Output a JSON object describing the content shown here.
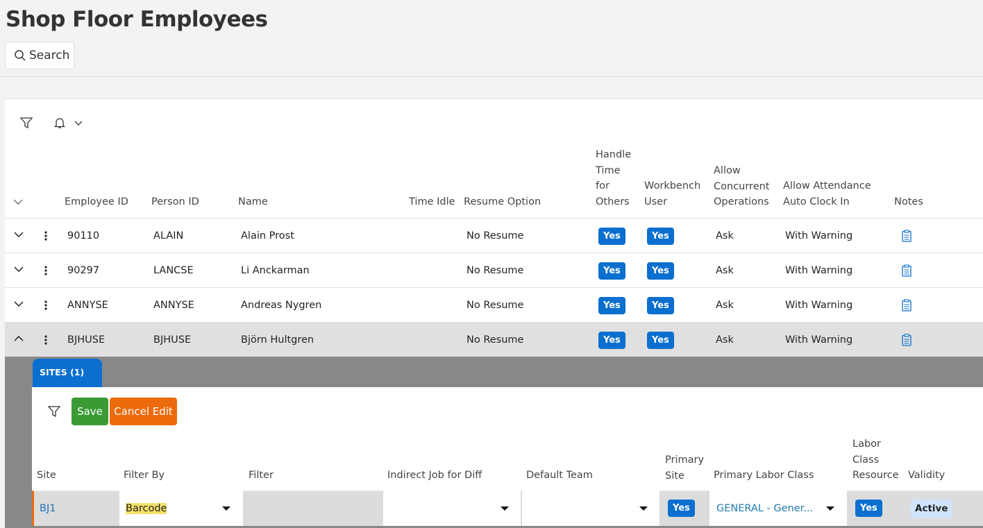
{
  "page": {
    "title": "Shop Floor Employees",
    "search_label": "Search"
  },
  "grid": {
    "headers": {
      "employee_id": "Employee ID",
      "person_id": "Person ID",
      "name": "Name",
      "time_idle": "Time Idle",
      "resume_option": "Resume Option",
      "handle_time": [
        "Handle",
        "Time",
        "for",
        "Others"
      ],
      "workbench": [
        "Workbench",
        "User"
      ],
      "concurrent": [
        "Allow",
        "Concurrent",
        "Operations"
      ],
      "attendance": [
        "Allow Attendance",
        "Auto Clock In"
      ],
      "notes": "Notes"
    },
    "rows": [
      {
        "employee_id": "90110",
        "person_id": "ALAIN",
        "name": "Alain Prost",
        "time_idle": "",
        "resume_option": "No Resume",
        "handle_time": "Yes",
        "workbench": "Yes",
        "concurrent": "Ask",
        "attendance": "With Warning",
        "expanded": false
      },
      {
        "employee_id": "90297",
        "person_id": "LANCSE",
        "name": "Li Anckarman",
        "time_idle": "",
        "resume_option": "No Resume",
        "handle_time": "Yes",
        "workbench": "Yes",
        "concurrent": "Ask",
        "attendance": "With Warning",
        "expanded": false
      },
      {
        "employee_id": "ANNYSE",
        "person_id": "ANNYSE",
        "name": "Andreas Nygren",
        "time_idle": "",
        "resume_option": "No Resume",
        "handle_time": "Yes",
        "workbench": "Yes",
        "concurrent": "Ask",
        "attendance": "With Warning",
        "expanded": false
      },
      {
        "employee_id": "BJHUSE",
        "person_id": "BJHUSE",
        "name": "Björn Hultgren",
        "time_idle": "",
        "resume_option": "No Resume",
        "handle_time": "Yes",
        "workbench": "Yes",
        "concurrent": "Ask",
        "attendance": "With Warning",
        "expanded": true
      }
    ]
  },
  "sites": {
    "tab_label": "SITES (1)",
    "save_label": "Save",
    "cancel_label": "Cancel Edit",
    "headers": {
      "site": "Site",
      "filter_by": "Filter By",
      "filter": "Filter",
      "indirect_job": "Indirect Job for Diff",
      "default_team": "Default Team",
      "primary_site": [
        "Primary",
        "Site"
      ],
      "primary_labor_class": "Primary Labor Class",
      "labor_class_resource": [
        "Labor",
        "Class",
        "Resource"
      ],
      "validity": "Validity"
    },
    "row": {
      "site": "BJ1",
      "filter_by": "Barcode",
      "filter": "",
      "indirect_job": "",
      "default_team": "",
      "primary_site": "Yes",
      "primary_labor_class": "GENERAL - Gener...",
      "labor_class_resource": "Yes",
      "validity": "Active"
    }
  },
  "colors": {
    "accent": "#0b6fcf",
    "save": "#3a9b35",
    "cancel": "#ec6a0c",
    "highlight": "#f4e06a"
  }
}
